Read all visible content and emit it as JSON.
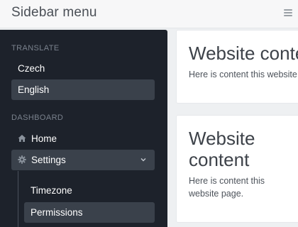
{
  "app": {
    "title": "Sidebar menu"
  },
  "icons": {
    "menu": "hamburger-icon",
    "home": "home-icon",
    "settings": "gear-icon",
    "chevron": "chevron-down-icon"
  },
  "colors": {
    "sidebar_bg": "#1d222b",
    "active_bg": "#3a414b",
    "page_bg": "#eef0f2"
  },
  "sidebar": {
    "translate": {
      "label": "TRANSLATE",
      "items": [
        {
          "label": "Czech"
        },
        {
          "label": "English"
        }
      ]
    },
    "dashboard": {
      "label": "DASHBOARD",
      "items": [
        {
          "label": "Home"
        },
        {
          "label": "Settings"
        }
      ],
      "submenu": [
        {
          "label": "Timezone"
        },
        {
          "label": "Permissions"
        }
      ]
    }
  },
  "cards": [
    {
      "title": "Website content",
      "text": "Here is content this website page."
    },
    {
      "title_line1": "Website",
      "title_line2": "content",
      "text_line1": "Here is content this",
      "text_line2": "website page."
    }
  ]
}
